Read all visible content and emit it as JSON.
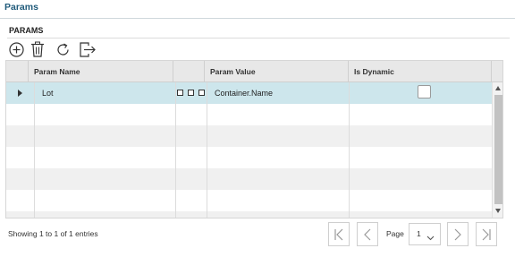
{
  "header": {
    "title": "Params"
  },
  "section": {
    "title": "PARAMS"
  },
  "toolbar": {
    "icons": [
      "add-icon",
      "delete-icon",
      "refresh-icon",
      "export-icon"
    ]
  },
  "table": {
    "columns": [
      "Param Name",
      "",
      "Param Value",
      "Is Dynamic"
    ],
    "rows": [
      {
        "param_name": "Lot",
        "param_value": "Container.Name",
        "is_dynamic": false
      }
    ]
  },
  "pagination": {
    "summary": "Showing 1 to 1 of 1 entries",
    "page_label": "Page",
    "current_page": "1"
  },
  "colors": {
    "title": "#1f5a7a",
    "selected_row": "#cde6ec",
    "header_bg": "#e8e8e8"
  }
}
